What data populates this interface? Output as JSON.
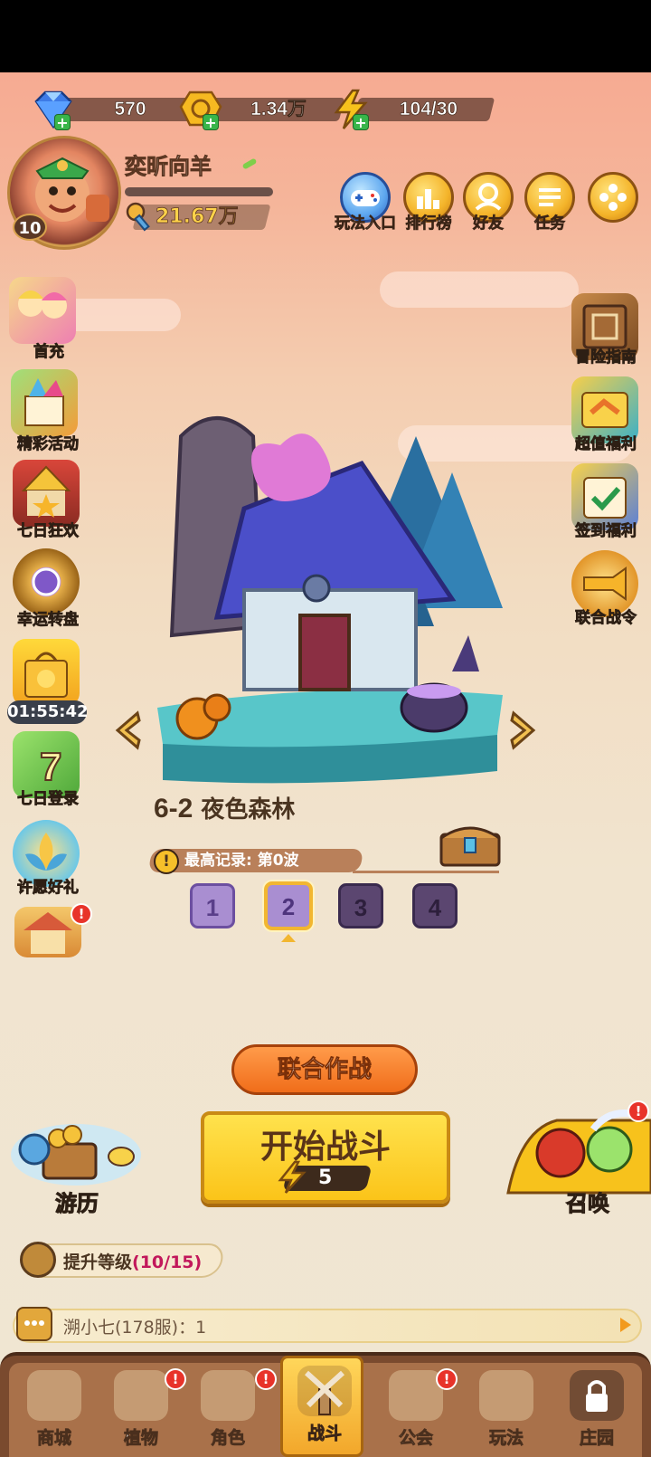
{
  "resources": {
    "diamonds": "570",
    "gold": "1.34万",
    "energy": "104/30"
  },
  "player": {
    "name": "奕昕向羊",
    "level": "10",
    "power": "21.67万"
  },
  "top_menu": [
    {
      "label": "玩法入口"
    },
    {
      "label": "排行榜"
    },
    {
      "label": "好友"
    },
    {
      "label": "任务"
    },
    {
      "label": ""
    }
  ],
  "left_menu": [
    {
      "label": "首充"
    },
    {
      "label": "精彩活动"
    },
    {
      "label": "七日狂欢"
    },
    {
      "label": "幸运转盘"
    },
    {
      "label": "01:55:42"
    },
    {
      "label": "七日登录"
    },
    {
      "label": "许愿好礼"
    }
  ],
  "right_menu": [
    {
      "label": "冒险指南"
    },
    {
      "label": "超值福利"
    },
    {
      "label": "签到福利"
    },
    {
      "label": "联合战令"
    }
  ],
  "level": {
    "code": "6-2",
    "name": "夜色森林",
    "record": "最高记录: 第0波",
    "info_glyph": "!",
    "difficulties": [
      "1",
      "2",
      "3",
      "4"
    ],
    "selected_difficulty": "2"
  },
  "actions": {
    "coop": "联合作战",
    "start": "开始战斗",
    "start_cost": "5",
    "travel": "游历",
    "summon": "召唤"
  },
  "upgrade": {
    "label": "提升等级",
    "progress": "(10/15)"
  },
  "chat": {
    "message": "溯小七(178服)：1"
  },
  "bottom_nav": [
    {
      "label": "商城",
      "badge": ""
    },
    {
      "label": "植物",
      "badge": "!"
    },
    {
      "label": "角色",
      "badge": "!"
    },
    {
      "label": "战斗",
      "badge": ""
    },
    {
      "label": "公会",
      "badge": "!"
    },
    {
      "label": "玩法",
      "badge": ""
    },
    {
      "label": "庄园",
      "badge": ""
    }
  ],
  "colors": {
    "accent_orange": "#f06d1a",
    "start_yellow": "#fbc419",
    "badge_red": "#e8332a"
  }
}
